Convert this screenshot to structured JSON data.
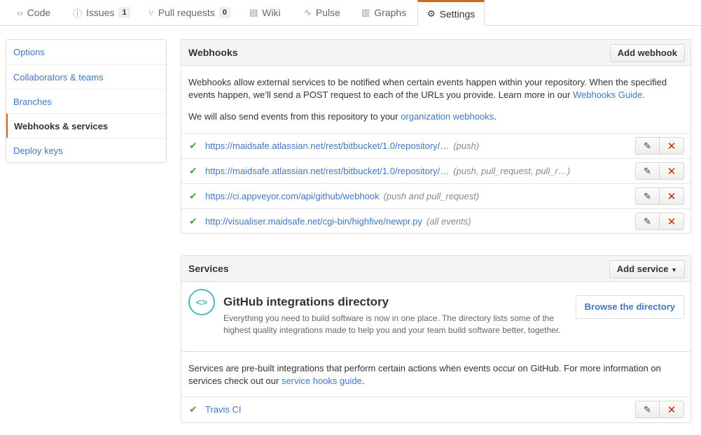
{
  "tabs": [
    {
      "icon": "‹›",
      "label": "Code"
    },
    {
      "icon": "ⓘ",
      "label": "Issues",
      "count": "1"
    },
    {
      "icon": "⑂",
      "label": "Pull requests",
      "count": "0"
    },
    {
      "icon": "▤",
      "label": "Wiki"
    },
    {
      "icon": "∿",
      "label": "Pulse"
    },
    {
      "icon": "▥",
      "label": "Graphs"
    },
    {
      "icon": "⚙",
      "label": "Settings"
    }
  ],
  "sidebar": {
    "items": [
      {
        "label": "Options"
      },
      {
        "label": "Collaborators & teams"
      },
      {
        "label": "Branches"
      },
      {
        "label": "Webhooks & services"
      },
      {
        "label": "Deploy keys"
      }
    ]
  },
  "webhooks": {
    "title": "Webhooks",
    "add_button": "Add webhook",
    "desc_part1": "Webhooks allow external services to be notified when certain events happen within your repository. When the specified events happen, we’ll send a POST request to each of the URLs you provide. Learn more in our ",
    "desc_link": "Webhooks Guide",
    "desc_part1_end": ".",
    "desc2_part1": "We will also send events from this repository to your ",
    "desc2_link": "organization webhooks",
    "desc2_end": ".",
    "hooks": [
      {
        "url": "https://maidsafe.atlassian.net/rest/bitbucket/1.0/repository/…",
        "events": "(push)"
      },
      {
        "url": "https://maidsafe.atlassian.net/rest/bitbucket/1.0/repository/…",
        "events": "(push, pull_request, pull_r…)"
      },
      {
        "url": "https://ci.appveyor.com/api/github/webhook",
        "events": "(push and pull_request)"
      },
      {
        "url": "http://visualiser.maidsafe.net/cgi-bin/highfive/newpr.py",
        "events": "(all events)"
      }
    ]
  },
  "services": {
    "title": "Services",
    "add_button": "Add service",
    "integrations": {
      "icon": "<>",
      "title": "GitHub integrations directory",
      "text": "Everything you need to build software is now in one place. The directory lists some of the highest quality integrations made to help you and your team build software better, together.",
      "button": "Browse the directory"
    },
    "desc_part1": "Services are pre-built integrations that perform certain actions when events occur on GitHub. For more information on services check out our ",
    "desc_link": "service hooks guide",
    "desc_end": ".",
    "items": [
      {
        "name": "Travis CI"
      }
    ]
  },
  "colors": {
    "accent": "#d26911",
    "link": "#4078c0",
    "success": "#55a532",
    "danger": "#bd2c00",
    "integration": "#4cb8c4"
  }
}
